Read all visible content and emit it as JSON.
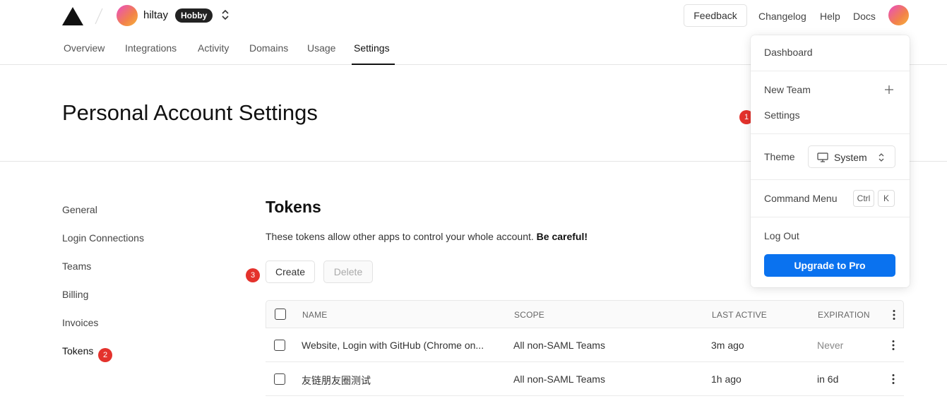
{
  "header": {
    "team_name": "hiltay",
    "plan_badge": "Hobby",
    "feedback_label": "Feedback",
    "changelog_label": "Changelog",
    "help_label": "Help",
    "docs_label": "Docs"
  },
  "tabs": [
    {
      "label": "Overview"
    },
    {
      "label": "Integrations"
    },
    {
      "label": "Activity"
    },
    {
      "label": "Domains"
    },
    {
      "label": "Usage"
    },
    {
      "label": "Settings",
      "active": true
    }
  ],
  "page": {
    "title": "Personal Account Settings"
  },
  "sidebar": {
    "items": [
      {
        "label": "General"
      },
      {
        "label": "Login Connections"
      },
      {
        "label": "Teams"
      },
      {
        "label": "Billing"
      },
      {
        "label": "Invoices"
      },
      {
        "label": "Tokens",
        "active": true
      }
    ]
  },
  "tokens": {
    "title": "Tokens",
    "description": "These tokens allow other apps to control your whole account.",
    "warning": "Be careful!",
    "create_label": "Create",
    "delete_label": "Delete",
    "columns": [
      "NAME",
      "SCOPE",
      "LAST ACTIVE",
      "EXPIRATION"
    ],
    "rows": [
      {
        "name": "Website, Login with GitHub (Chrome on...",
        "scope": "All non-SAML Teams",
        "last_active": "3m ago",
        "expiration": "Never"
      },
      {
        "name": "友链朋友圈测试",
        "scope": "All non-SAML Teams",
        "last_active": "1h ago",
        "expiration": "in 6d"
      }
    ]
  },
  "markers": [
    "1",
    "2",
    "3"
  ],
  "dropdown": {
    "dashboard": "Dashboard",
    "new_team": "New Team",
    "settings": "Settings",
    "theme_label": "Theme",
    "theme_value": "System",
    "command_menu": "Command Menu",
    "kbd_ctrl": "Ctrl",
    "kbd_k": "K",
    "log_out": "Log Out",
    "upgrade": "Upgrade to Pro"
  },
  "colors": {
    "accent": "#0a72ef",
    "marker": "#e4322c",
    "badge_bg": "#222222"
  },
  "icons": [
    "triangle-logo-icon",
    "slash-divider-icon",
    "chevron-updown-icon",
    "plus-icon",
    "monitor-icon",
    "kebab-menu-icon",
    "checkbox-icon"
  ]
}
